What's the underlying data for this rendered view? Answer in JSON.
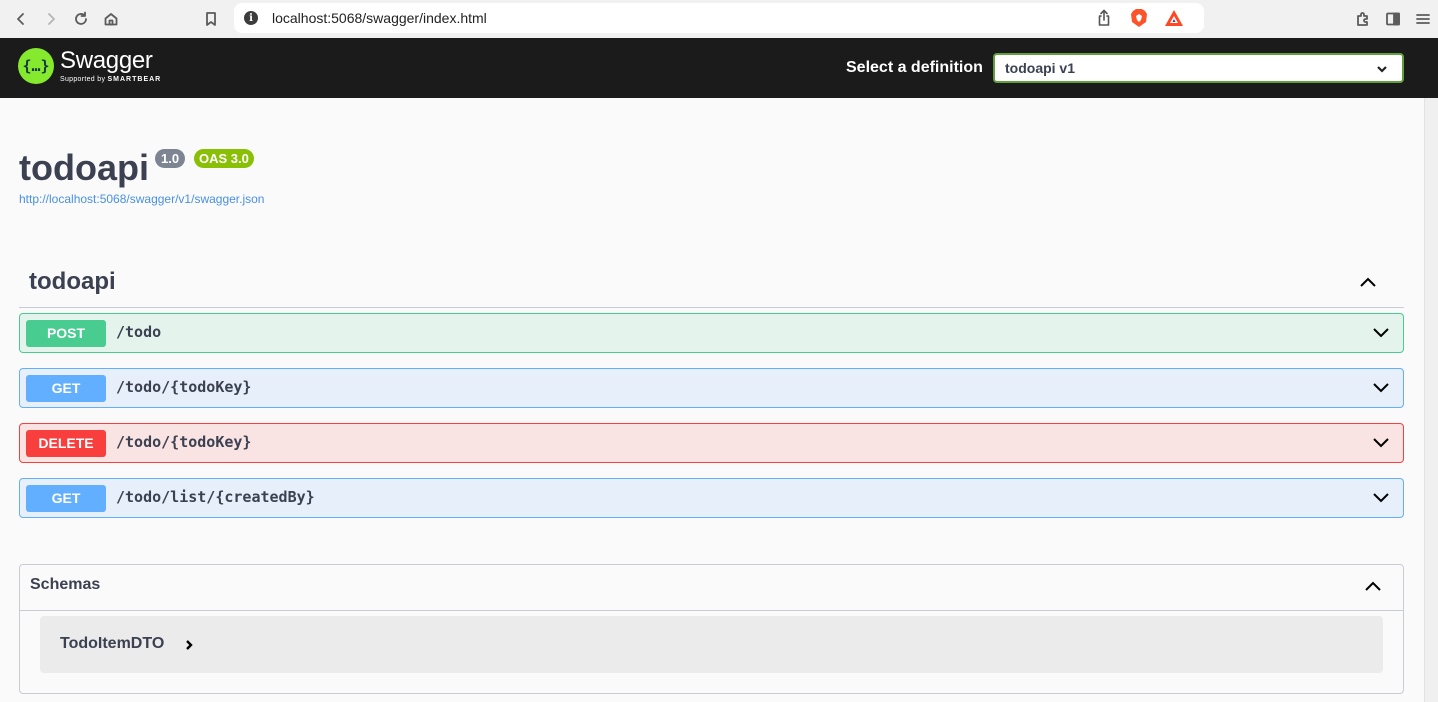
{
  "browser": {
    "url": "localhost:5068/swagger/index.html",
    "icons": [
      "back-icon",
      "forward-icon",
      "reload-icon",
      "home-icon",
      "bookmark-icon",
      "site-info-icon",
      "share-icon",
      "brave-shields-icon",
      "brave-rewards-icon",
      "extensions-icon",
      "sidebar-icon",
      "menu-icon"
    ]
  },
  "header": {
    "logo_name": "Swagger",
    "logo_sub_prefix": "Supported by",
    "logo_sub_brand": "SMARTBEAR",
    "definition_label": "Select a definition",
    "definition_selected": "todoapi v1"
  },
  "info": {
    "title": "todoapi",
    "version": "1.0",
    "oas": "OAS 3.0",
    "spec_url": "http://localhost:5068/swagger/v1/swagger.json"
  },
  "tag": {
    "name": "todoapi",
    "operations": [
      {
        "method": "POST",
        "path": "/todo"
      },
      {
        "method": "GET",
        "path": "/todo/{todoKey}"
      },
      {
        "method": "DELETE",
        "path": "/todo/{todoKey}"
      },
      {
        "method": "GET",
        "path": "/todo/list/{createdBy}"
      }
    ]
  },
  "schemas": {
    "title": "Schemas",
    "models": [
      "TodoItemDTO"
    ]
  },
  "colors": {
    "post": "#49cc90",
    "get": "#61affe",
    "delete": "#f93e3e",
    "topbar": "#1b1b1b",
    "logo": "#85ea2d",
    "oas_badge": "#89bf04",
    "version_badge": "#7d8492"
  }
}
